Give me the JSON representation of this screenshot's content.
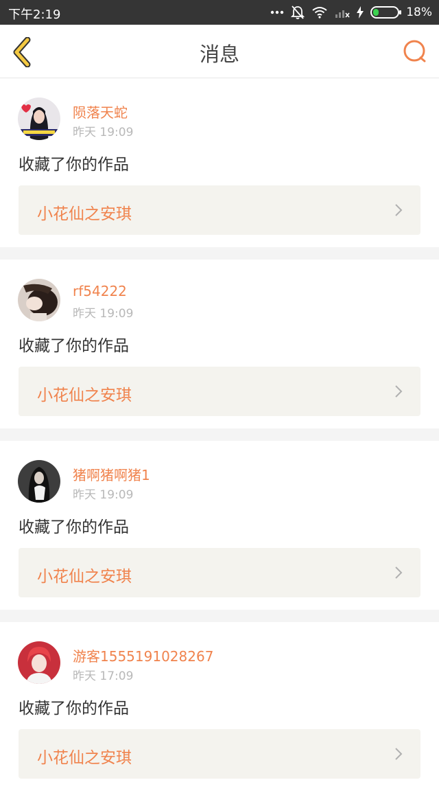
{
  "status_bar": {
    "time": "下午2:19",
    "battery": "18%",
    "icons": [
      "more-dots-icon",
      "bell-off-icon",
      "wifi-icon",
      "cellular-off-icon",
      "charging-icon",
      "battery-icon"
    ]
  },
  "nav": {
    "title": "消息",
    "back_icon": "chevron-left-icon",
    "search_icon": "search-icon"
  },
  "colors": {
    "accent": "#f0834d",
    "back_icon_fill": "#f4c942"
  },
  "messages": [
    {
      "username": "陨落天蛇",
      "time": "昨天 19:09",
      "action": "收藏了你的作品",
      "work_title": "小花仙之安琪"
    },
    {
      "username": "rf54222",
      "time": "昨天 19:09",
      "action": "收藏了你的作品",
      "work_title": "小花仙之安琪"
    },
    {
      "username": "猪啊猪啊猪1",
      "time": "昨天 19:09",
      "action": "收藏了你的作品",
      "work_title": "小花仙之安琪"
    },
    {
      "username": "游客1555191028267",
      "time": "昨天 17:09",
      "action": "收藏了你的作品",
      "work_title": "小花仙之安琪"
    }
  ]
}
